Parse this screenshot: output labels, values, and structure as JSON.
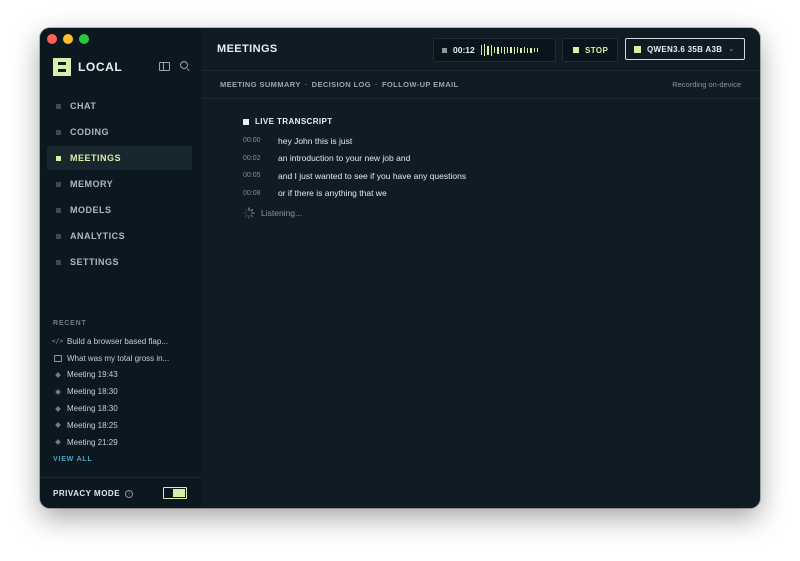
{
  "app": {
    "brand": "LOCAL"
  },
  "sidebar": {
    "nav": [
      {
        "label": "CHAT",
        "active": false
      },
      {
        "label": "CODING",
        "active": false
      },
      {
        "label": "MEETINGS",
        "active": true
      },
      {
        "label": "MEMORY",
        "active": false
      },
      {
        "label": "MODELS",
        "active": false
      },
      {
        "label": "ANALYTICS",
        "active": false
      },
      {
        "label": "SETTINGS",
        "active": false
      }
    ],
    "recent_heading": "RECENT",
    "recent": [
      {
        "icon": "code-icon",
        "label": "Build a browser based flap..."
      },
      {
        "icon": "chat-bubble-icon",
        "label": "What was my total gross in..."
      },
      {
        "icon": "meeting-icon",
        "label": "Meeting 19:43"
      },
      {
        "icon": "meeting-icon",
        "label": "Meeting 18:30"
      },
      {
        "icon": "meeting-icon",
        "label": "Meeting 18:30"
      },
      {
        "icon": "meeting-icon",
        "label": "Meeting 18:25"
      },
      {
        "icon": "meeting-icon",
        "label": "Meeting 21:29"
      }
    ],
    "view_all": "VIEW ALL",
    "privacy_mode": {
      "label": "PRIVACY MODE",
      "enabled": true
    }
  },
  "header": {
    "title": "MEETINGS",
    "timer": "00:12",
    "stop_label": "STOP",
    "model_label": "QWEN3.6 35B A3B"
  },
  "subbar": {
    "summary_label": "MEETING SUMMARY",
    "decision_label": "DECISION LOG",
    "followup_label": "FOLLOW-UP EMAIL",
    "separator": "·",
    "status": "Recording on-device"
  },
  "transcript": {
    "title": "LIVE TRANSCRIPT",
    "lines": [
      {
        "time": "00:00",
        "text": "hey John this is just"
      },
      {
        "time": "00:02",
        "text": "an introduction to your new job and"
      },
      {
        "time": "00:05",
        "text": "and I just wanted to see if you have any questions"
      },
      {
        "time": "00:08",
        "text": "or if there is anything that we"
      }
    ],
    "listening": "Listening..."
  },
  "colors": {
    "accent": "#d9eea6",
    "background": "#0f1c24",
    "sidebar": "#0b1820",
    "link": "#4ea4c4"
  }
}
